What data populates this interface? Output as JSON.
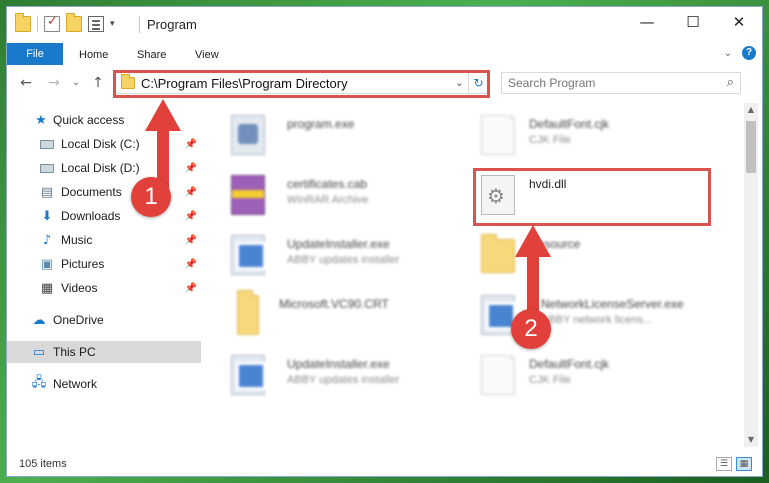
{
  "window": {
    "title": "Program",
    "controls": {
      "minimize": "—",
      "maximize": "☐",
      "close": "✕"
    }
  },
  "ribbon": {
    "tabs": [
      "File",
      "Home",
      "Share",
      "View"
    ],
    "help": "?"
  },
  "address_bar": {
    "path": "C:\\Program Files\\Program Directory"
  },
  "search": {
    "placeholder": "Search Program"
  },
  "nav_pane": {
    "items": [
      {
        "label": "Quick access",
        "icon": "star-icon"
      },
      {
        "label": "Local Disk (C:)",
        "icon": "drive-icon",
        "pinned": true
      },
      {
        "label": "Local Disk (D:)",
        "icon": "drive-icon",
        "pinned": true
      },
      {
        "label": "Documents",
        "icon": "documents-icon",
        "pinned": true
      },
      {
        "label": "Downloads",
        "icon": "downloads-icon",
        "pinned": true
      },
      {
        "label": "Music",
        "icon": "music-icon",
        "pinned": true
      },
      {
        "label": "Pictures",
        "icon": "pictures-icon",
        "pinned": true
      },
      {
        "label": "Videos",
        "icon": "videos-icon",
        "pinned": true
      },
      {
        "label": "OneDrive",
        "icon": "onedrive-icon"
      },
      {
        "label": "This PC",
        "icon": "computer-icon",
        "selected": true
      },
      {
        "label": "Network",
        "icon": "network-icon"
      }
    ]
  },
  "files": [
    {
      "name": "program.exe",
      "type": "",
      "icon": "program-exe-icon"
    },
    {
      "name": "DefaultFont.cjk",
      "type": "CJK File",
      "icon": "document-icon"
    },
    {
      "name": "certificates.cab",
      "type": "WinRAR Archive",
      "icon": "winrar-icon"
    },
    {
      "name": "hvdi.dll",
      "type": "",
      "icon": "dll-icon",
      "highlighted": true
    },
    {
      "name": "UpdateInstaller.exe",
      "type": "ABBY updates installer",
      "icon": "installer-icon"
    },
    {
      "name": "Resource",
      "type": "",
      "icon": "folder-icon"
    },
    {
      "name": "Microsoft.VC90.CRT",
      "type": "",
      "icon": "folder-icon"
    },
    {
      "name": "NetworkLicenseServer.exe",
      "type": "ABBY network licens...",
      "icon": "installer-icon"
    },
    {
      "name": "UpdateInstaller.exe",
      "type": "ABBY updates installer",
      "icon": "installer-icon"
    },
    {
      "name": "DefaultFont.cjk",
      "type": "CJK File",
      "icon": "document-icon"
    }
  ],
  "status_bar": {
    "item_count": "105 items"
  },
  "annotations": {
    "step_1": "1",
    "step_2": "2",
    "color": "#e2403a"
  }
}
